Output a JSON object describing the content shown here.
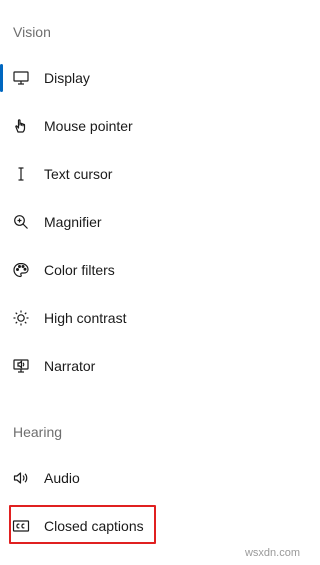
{
  "sections": {
    "vision": "Vision",
    "hearing": "Hearing"
  },
  "vision_items": [
    {
      "label": "Display",
      "icon": "monitor-icon",
      "selected": true
    },
    {
      "label": "Mouse pointer",
      "icon": "mouse-pointer-icon"
    },
    {
      "label": "Text cursor",
      "icon": "text-cursor-icon"
    },
    {
      "label": "Magnifier",
      "icon": "magnifier-icon"
    },
    {
      "label": "Color filters",
      "icon": "color-palette-icon"
    },
    {
      "label": "High contrast",
      "icon": "brightness-icon"
    },
    {
      "label": "Narrator",
      "icon": "narrator-icon"
    }
  ],
  "hearing_items": [
    {
      "label": "Audio",
      "icon": "speaker-icon"
    },
    {
      "label": "Closed captions",
      "icon": "closed-captions-icon"
    }
  ],
  "watermark": "wsxdn.com",
  "colors": {
    "accent": "#0067c0",
    "highlight": "#e02020",
    "section_header": "#6e6e6e"
  }
}
